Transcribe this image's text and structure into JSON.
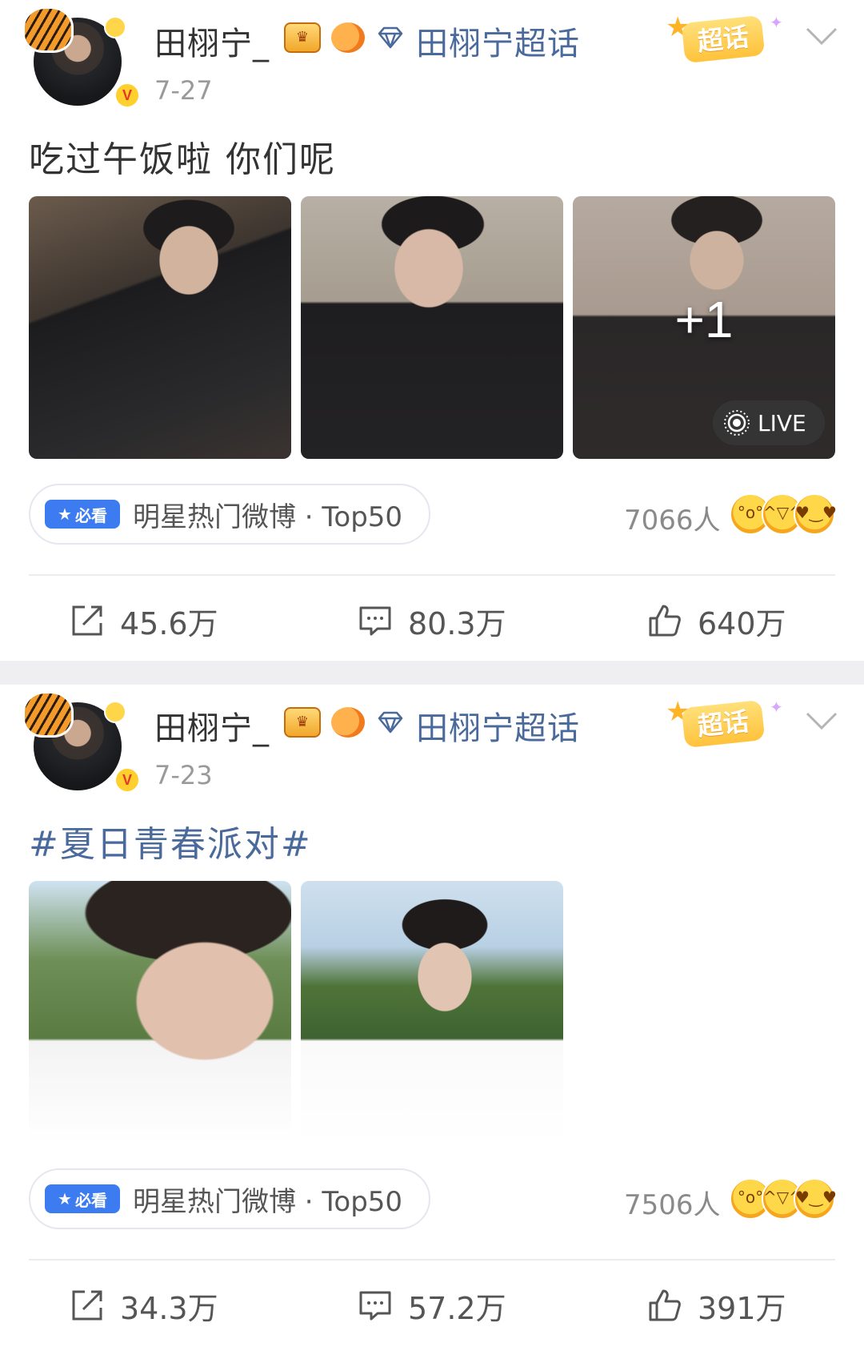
{
  "posts": [
    {
      "username": "田栩宁_",
      "supertopic_link": "田栩宁超话",
      "super_tag": "超话",
      "timestamp": "7-27",
      "text": "吃过午饭啦 你们呢",
      "images": 3,
      "more_count": "+1",
      "live_label": "LIVE",
      "hot_badge": "必看",
      "hot_text": "明星热门微博 · Top50",
      "reaction_count": "7066人",
      "shares": "45.6万",
      "comments": "80.3万",
      "likes": "640万"
    },
    {
      "username": "田栩宁_",
      "supertopic_link": "田栩宁超话",
      "super_tag": "超话",
      "timestamp": "7-23",
      "text": "#夏日青春派对#",
      "images": 2,
      "hot_badge": "必看",
      "hot_text": "明星热门微博 · Top50",
      "reaction_count": "7506人",
      "shares": "34.3万",
      "comments": "57.2万",
      "likes": "391万"
    }
  ],
  "colors": {
    "link_blue": "#4a6a9c",
    "must_see_blue": "#3c7cf0",
    "verified_yellow": "#ffcf2d"
  },
  "icons": [
    "verified-icon",
    "crown-badge-icon",
    "fish-badge-icon",
    "diamond-icon",
    "chevron-down-icon",
    "share-icon",
    "comment-icon",
    "like-icon",
    "live-icon",
    "star-icon",
    "emoji-surprised-icon",
    "emoji-laugh-icon",
    "emoji-heart-eyes-icon"
  ]
}
